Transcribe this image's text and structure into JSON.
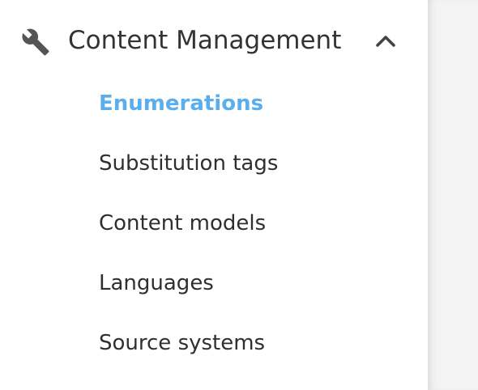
{
  "sidebar": {
    "group": {
      "title": "Content Management",
      "icon": "wrench-icon",
      "expanded": true
    },
    "items": [
      {
        "label": "Enumerations",
        "active": true
      },
      {
        "label": "Substitution tags",
        "active": false
      },
      {
        "label": "Content models",
        "active": false
      },
      {
        "label": "Languages",
        "active": false
      },
      {
        "label": "Source systems",
        "active": false
      }
    ]
  },
  "colors": {
    "active_item": "#5aaeee",
    "text": "#333333",
    "icon": "#555555",
    "content_background": "#f3f3f3"
  }
}
